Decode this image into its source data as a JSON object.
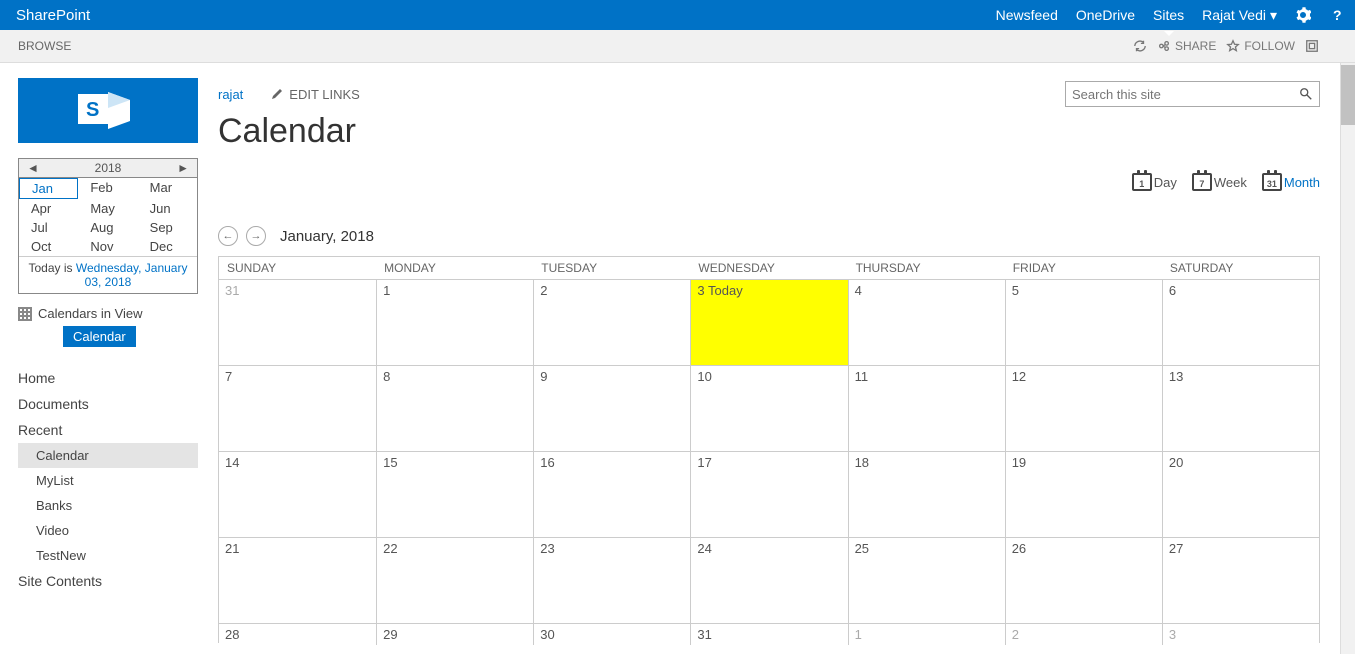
{
  "suite": {
    "brand": "SharePoint",
    "links": [
      "Newsfeed",
      "OneDrive",
      "Sites"
    ],
    "user": "Rajat Vedi"
  },
  "ribbon": {
    "tab": "BROWSE",
    "share": "SHARE",
    "follow": "FOLLOW"
  },
  "breadcrumb": {
    "site": "rajat",
    "editLinks": "EDIT LINKS"
  },
  "search": {
    "placeholder": "Search this site"
  },
  "page": {
    "title": "Calendar"
  },
  "miniCal": {
    "year": "2018",
    "months": [
      "Jan",
      "Feb",
      "Mar",
      "Apr",
      "May",
      "Jun",
      "Jul",
      "Aug",
      "Sep",
      "Oct",
      "Nov",
      "Dec"
    ],
    "selected": "Jan",
    "todayPrefix": "Today is ",
    "todayLink": "Wednesday, January 03, 2018"
  },
  "calendarsInView": {
    "label": "Calendars in View",
    "badge": "Calendar"
  },
  "nav": {
    "items": [
      "Home",
      "Documents",
      "Recent"
    ],
    "recent": [
      "Calendar",
      "MyList",
      "Banks",
      "Video",
      "TestNew"
    ],
    "siteContents": "Site Contents"
  },
  "views": {
    "day": "Day",
    "week": "Week",
    "month": "Month",
    "dayNum": "1",
    "weekNum": "7",
    "monthNum": "31"
  },
  "monthNav": {
    "label": "January, 2018"
  },
  "calendar": {
    "days": [
      "SUNDAY",
      "MONDAY",
      "TUESDAY",
      "WEDNESDAY",
      "THURSDAY",
      "FRIDAY",
      "SATURDAY"
    ],
    "weeks": [
      [
        {
          "n": "31",
          "muted": true
        },
        {
          "n": "1"
        },
        {
          "n": "2"
        },
        {
          "n": "3 Today",
          "today": true
        },
        {
          "n": "4"
        },
        {
          "n": "5"
        },
        {
          "n": "6"
        }
      ],
      [
        {
          "n": "7"
        },
        {
          "n": "8"
        },
        {
          "n": "9"
        },
        {
          "n": "10"
        },
        {
          "n": "11"
        },
        {
          "n": "12"
        },
        {
          "n": "13"
        }
      ],
      [
        {
          "n": "14"
        },
        {
          "n": "15"
        },
        {
          "n": "16"
        },
        {
          "n": "17"
        },
        {
          "n": "18"
        },
        {
          "n": "19"
        },
        {
          "n": "20"
        }
      ],
      [
        {
          "n": "21"
        },
        {
          "n": "22"
        },
        {
          "n": "23"
        },
        {
          "n": "24"
        },
        {
          "n": "25"
        },
        {
          "n": "26"
        },
        {
          "n": "27"
        }
      ],
      [
        {
          "n": "28"
        },
        {
          "n": "29"
        },
        {
          "n": "30"
        },
        {
          "n": "31"
        },
        {
          "n": "1",
          "muted": true
        },
        {
          "n": "2",
          "muted": true
        },
        {
          "n": "3",
          "muted": true
        }
      ]
    ]
  }
}
